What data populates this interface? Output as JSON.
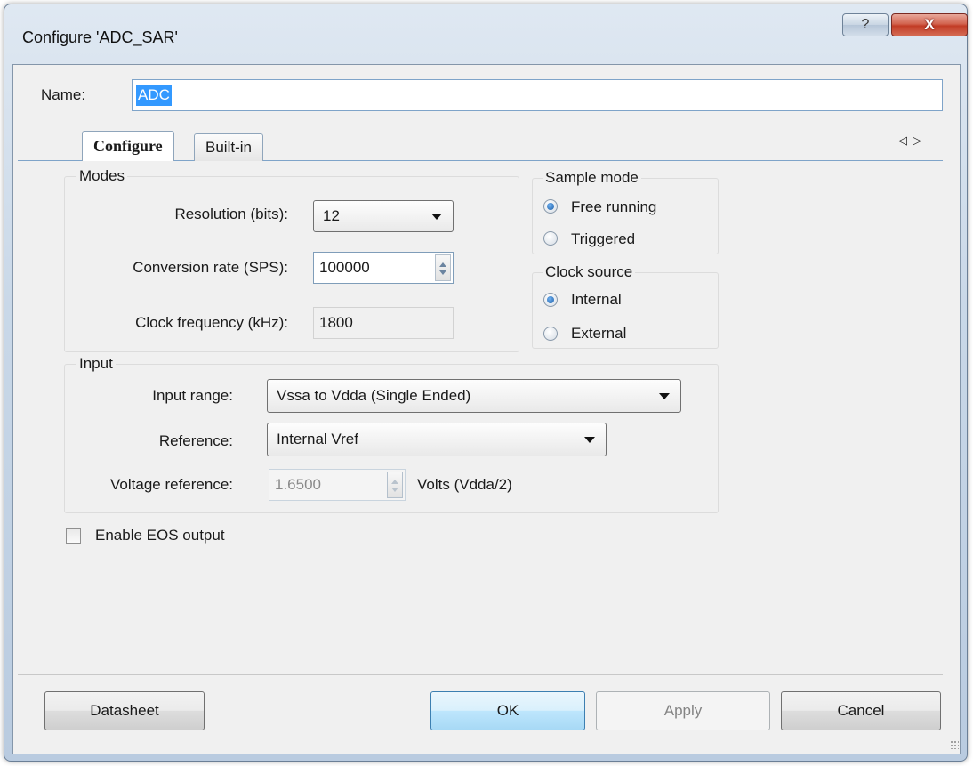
{
  "window": {
    "title": "Configure 'ADC_SAR'",
    "help_label": "?",
    "close_label": "X"
  },
  "name": {
    "label": "Name:",
    "value": "ADC"
  },
  "tabs": [
    {
      "label": "Configure",
      "active": true
    },
    {
      "label": "Built-in",
      "active": false
    }
  ],
  "nav": {
    "prev": "◁",
    "next": "▷"
  },
  "modes": {
    "title": "Modes",
    "resolution_label": "Resolution (bits):",
    "resolution_value": "12",
    "conversion_label": "Conversion rate (SPS):",
    "conversion_value": "100000",
    "clock_freq_label": "Clock frequency (kHz):",
    "clock_freq_value": "1800"
  },
  "sample_mode": {
    "title": "Sample mode",
    "options": [
      {
        "label": "Free running",
        "selected": true
      },
      {
        "label": "Triggered",
        "selected": false
      }
    ]
  },
  "clock_source": {
    "title": "Clock source",
    "options": [
      {
        "label": "Internal",
        "selected": true
      },
      {
        "label": "External",
        "selected": false
      }
    ]
  },
  "input": {
    "title": "Input",
    "range_label": "Input range:",
    "range_value": "Vssa to Vdda (Single Ended)",
    "reference_label": "Reference:",
    "reference_value": "Internal Vref",
    "vref_label": "Voltage reference:",
    "vref_value": "1.6500",
    "vref_unit": "Volts (Vdda/2)"
  },
  "eos": {
    "label": "Enable EOS output",
    "checked": false
  },
  "buttons": {
    "datasheet": "Datasheet",
    "ok": "OK",
    "apply": "Apply",
    "cancel": "Cancel"
  },
  "colors": {
    "selection": "#3399ff",
    "close_button": "#c23c26",
    "default_button": "#bee6fd"
  }
}
